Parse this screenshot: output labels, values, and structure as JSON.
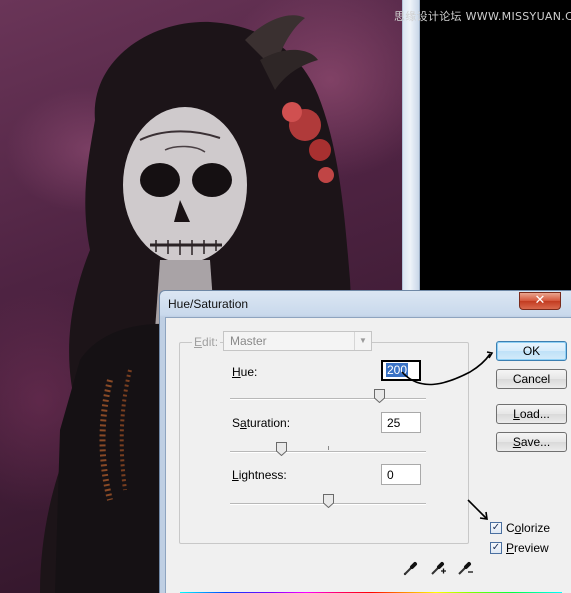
{
  "watermark": "思缘设计论坛 WWW.MISSYUAN.COM",
  "dialog": {
    "title": "Hue/Saturation",
    "close_glyph": "✕",
    "edit_label_prefix": "E",
    "edit_label_rest": "dit:",
    "edit_value": "Master",
    "hue": {
      "label_u": "H",
      "label_rest": "ue:",
      "value": "200",
      "level": 0.78
    },
    "saturation": {
      "label_pre": "S",
      "label_u": "a",
      "label_rest": "turation:",
      "value": "25",
      "level": 0.25
    },
    "lightness": {
      "label_u": "L",
      "label_rest": "ightness:",
      "value": "0",
      "level": 0.5
    },
    "buttons": {
      "ok": "OK",
      "cancel": "Cancel",
      "load_u": "L",
      "load_rest": "oad...",
      "save_u": "S",
      "save_rest": "ave..."
    },
    "colorize": {
      "label_u": "o",
      "label_pre": "C",
      "label_rest": "lorize",
      "checked": true
    },
    "preview": {
      "label_u": "P",
      "label_rest": "review",
      "checked": true
    },
    "eyedroppers": [
      "eyedropper-icon",
      "eyedropper-plus-icon",
      "eyedropper-minus-icon"
    ]
  },
  "colors": {
    "accent_selection": "#3a72c4",
    "close_button": "#c94a2f",
    "annotation": "#000000"
  }
}
